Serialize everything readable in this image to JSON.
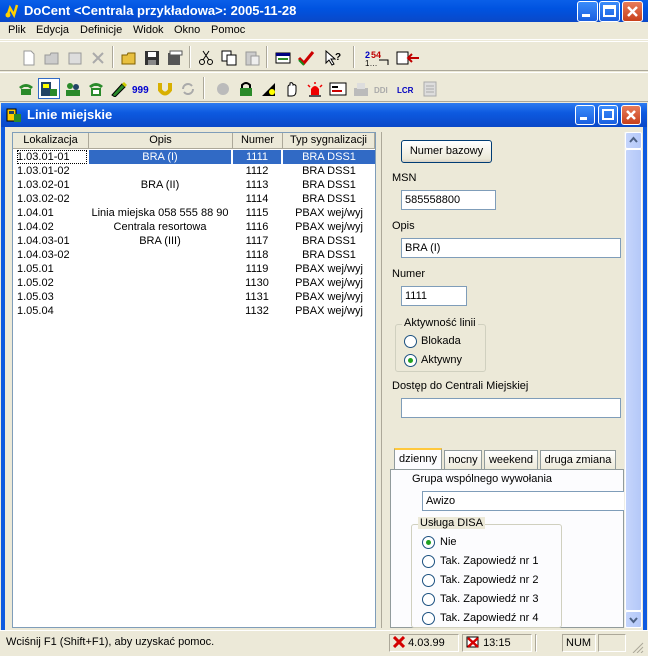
{
  "window": {
    "title": "DoCent <Centrala przykładowa>: 2005-11-28"
  },
  "menu": [
    "Plik",
    "Edycja",
    "Definicje",
    "Widok",
    "Okno",
    "Pomoc"
  ],
  "toolbar1": [
    "new-file-icon",
    "open-folder-icon",
    "properties-icon",
    "delete-icon",
    "open-icon",
    "save-icon",
    "save-as-icon",
    "cut-icon",
    "copy-icon",
    "paste-icon",
    "window-icon",
    "check-icon",
    "help-cursor-icon",
    "numbering-icon",
    "export-icon"
  ],
  "toolbar2": [
    "phone-icon",
    "extension-icon",
    "group-icon",
    "handset-icon",
    "pen-icon",
    "emergency-999-icon",
    "horseshoe-icon",
    "refresh-icon",
    "disabled-icon",
    "lock-icon",
    "tone-icon",
    "hand-icon",
    "alarm-icon",
    "card-icon",
    "fax-icon",
    "ddi-icon",
    "lcr-icon",
    "report-icon"
  ],
  "child_window": {
    "title": "Linie miejskie"
  },
  "list": {
    "columns": [
      "Lokalizacja",
      "Opis",
      "Numer",
      "Typ sygnalizacji"
    ],
    "rows": [
      [
        "1.03.01-01",
        "BRA (I)",
        "1111",
        "BRA DSS1"
      ],
      [
        "1.03.01-02",
        "",
        "1112",
        "BRA DSS1"
      ],
      [
        "1.03.02-01",
        "BRA (II)",
        "1113",
        "BRA DSS1"
      ],
      [
        "1.03.02-02",
        "",
        "1114",
        "BRA DSS1"
      ],
      [
        "1.04.01",
        "Linia miejska 058 555 88 90",
        "1115",
        "PBAX wej/wyj"
      ],
      [
        "1.04.02",
        "Centrala resortowa",
        "1116",
        "PBAX wej/wyj"
      ],
      [
        "1.04.03-01",
        "BRA (III)",
        "1117",
        "BRA DSS1"
      ],
      [
        "1.04.03-02",
        "",
        "1118",
        "BRA DSS1"
      ],
      [
        "1.05.01",
        "",
        "1119",
        "PBAX wej/wyj"
      ],
      [
        "1.05.02",
        "",
        "1130",
        "PBAX wej/wyj"
      ],
      [
        "1.05.03",
        "",
        "1131",
        "PBAX wej/wyj"
      ],
      [
        "1.05.04",
        "",
        "1132",
        "PBAX wej/wyj"
      ]
    ],
    "selected_index": 0
  },
  "form": {
    "base_number_button": "Numer bazowy",
    "msn_label": "MSN",
    "msn_value": "585558800",
    "opis_label": "Opis",
    "opis_value": "BRA (I)",
    "numer_label": "Numer",
    "numer_value": "1111",
    "activity_group": "Aktywność linii",
    "activity_options": [
      "Blokada",
      "Aktywny"
    ],
    "activity_selected": "Aktywny",
    "access_label": "Dostęp do Centrali Miejskiej",
    "access_value": "",
    "tabs": [
      "dzienny",
      "nocny",
      "weekend",
      "druga zmiana"
    ],
    "active_tab": "dzienny",
    "group_call_label": "Grupa wspólnego wywołania",
    "group_call_value": "Awizo",
    "disa_group": "Usługa DISA",
    "disa_options": [
      "Nie",
      "Tak. Zapowiedź nr 1",
      "Tak. Zapowiedź nr 2",
      "Tak. Zapowiedź nr 3",
      "Tak. Zapowiedź nr 4"
    ],
    "disa_selected": "Nie"
  },
  "status": {
    "help": "Wciśnij F1 (Shift+F1), aby uzyskać pomoc.",
    "version": "4.03.99",
    "time": "13:15",
    "num": "NUM"
  },
  "colors": {
    "title_bar": "#0a5fe8",
    "selection": "#316ac5",
    "face": "#ece9d8",
    "error": "#d40000"
  }
}
